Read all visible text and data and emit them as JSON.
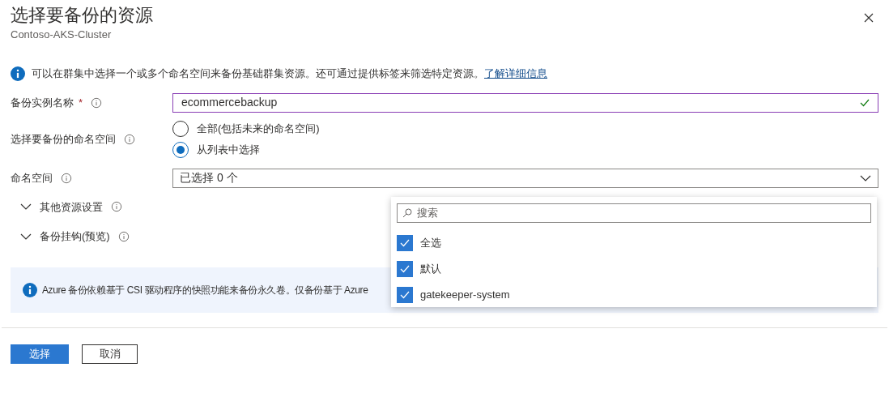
{
  "panel": {
    "title": "选择要备份的资源",
    "subtitle": "Contoso-AKS-Cluster"
  },
  "info": {
    "text": "可以在群集中选择一个或多个命名空间来备份基础群集资源。还可通过提供标签来筛选特定资源。",
    "link": "了解详细信息"
  },
  "instance_name": {
    "label": "备份实例名称",
    "required": "*",
    "value": "ecommercebackup",
    "valid": true
  },
  "namespace_scope": {
    "label": "选择要备份的命名空间",
    "options": [
      {
        "label": "全部(包括未来的命名空间)",
        "selected": false
      },
      {
        "label": "从列表中选择",
        "selected": true
      }
    ]
  },
  "namespaces": {
    "label": "命名空间",
    "value": "已选择 0 个",
    "expanded": true,
    "search_placeholder": "搜索",
    "items": [
      {
        "label": "全选",
        "checked": true
      },
      {
        "label": "默认",
        "checked": true
      },
      {
        "label": "gatekeeper-system",
        "checked": true
      }
    ]
  },
  "sections": [
    {
      "label": "其他资源设置",
      "expanded": false
    },
    {
      "label": "备份挂钩(预览)",
      "expanded": false
    }
  ],
  "banner": {
    "text": "Azure 备份依赖基于 CSI 驱动程序的快照功能来备份永久卷。仅备份基于 Azure"
  },
  "buttons": [
    {
      "label": "选择",
      "kind": "primary"
    },
    {
      "label": "取消",
      "kind": "secondary"
    }
  ]
}
